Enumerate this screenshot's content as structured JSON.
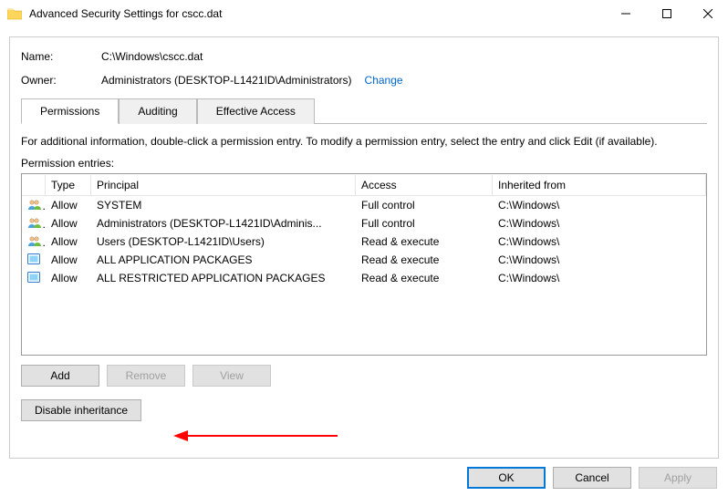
{
  "window": {
    "title": "Advanced Security Settings for cscc.dat",
    "minimize_tooltip": "Minimize",
    "maximize_tooltip": "Maximize",
    "close_tooltip": "Close"
  },
  "fields": {
    "name_label": "Name:",
    "name_value": "C:\\Windows\\cscc.dat",
    "owner_label": "Owner:",
    "owner_value": "Administrators (DESKTOP-L1421ID\\Administrators)",
    "change_link": "Change"
  },
  "tabs": {
    "permissions": "Permissions",
    "auditing": "Auditing",
    "effective_access": "Effective Access"
  },
  "hint_text": "For additional information, double-click a permission entry. To modify a permission entry, select the entry and click Edit (if available).",
  "entries_label": "Permission entries:",
  "columns": {
    "type": "Type",
    "principal": "Principal",
    "access": "Access",
    "inherited": "Inherited from"
  },
  "entries": [
    {
      "icon": "group",
      "type": "Allow",
      "principal": "SYSTEM",
      "access": "Full control",
      "inherited": "C:\\Windows\\"
    },
    {
      "icon": "group",
      "type": "Allow",
      "principal": "Administrators (DESKTOP-L1421ID\\Adminis...",
      "access": "Full control",
      "inherited": "C:\\Windows\\"
    },
    {
      "icon": "group",
      "type": "Allow",
      "principal": "Users (DESKTOP-L1421ID\\Users)",
      "access": "Read & execute",
      "inherited": "C:\\Windows\\"
    },
    {
      "icon": "package",
      "type": "Allow",
      "principal": "ALL APPLICATION PACKAGES",
      "access": "Read & execute",
      "inherited": "C:\\Windows\\"
    },
    {
      "icon": "package",
      "type": "Allow",
      "principal": "ALL RESTRICTED APPLICATION PACKAGES",
      "access": "Read & execute",
      "inherited": "C:\\Windows\\"
    }
  ],
  "buttons": {
    "add": "Add",
    "remove": "Remove",
    "view": "View",
    "disable_inheritance": "Disable inheritance",
    "ok": "OK",
    "cancel": "Cancel",
    "apply": "Apply"
  }
}
